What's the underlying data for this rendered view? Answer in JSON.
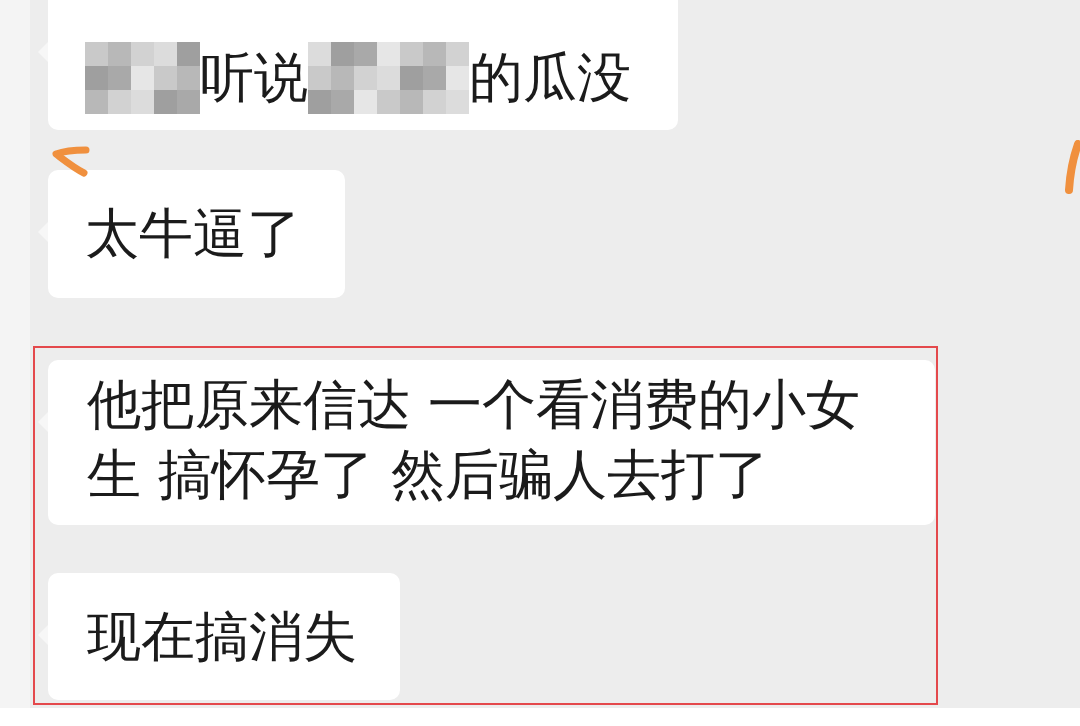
{
  "chat": {
    "messages": [
      {
        "segments": [
          {
            "kind": "mosaic"
          },
          {
            "kind": "text",
            "text": "听说"
          },
          {
            "kind": "mosaic"
          },
          {
            "kind": "text",
            "text": "的瓜没"
          }
        ]
      },
      {
        "segments": [
          {
            "kind": "text",
            "text": "太牛逼了"
          }
        ]
      }
    ],
    "highlighted_messages": [
      {
        "segments": [
          {
            "kind": "text",
            "text": "他把原来信达 一个看消费的小女生 搞怀孕了 然后骗人去打了"
          }
        ]
      },
      {
        "segments": [
          {
            "kind": "text",
            "text": "现在搞消失"
          }
        ]
      }
    ]
  }
}
